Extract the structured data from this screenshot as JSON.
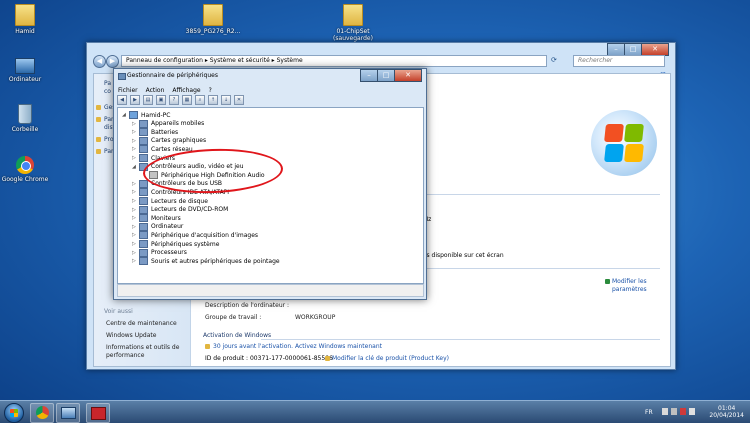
{
  "desktop": {
    "icons": [
      {
        "label": "Hamid"
      },
      {
        "label": "3859_PG276_R2..."
      },
      {
        "label": "01-ChipSet (sauvegarde)"
      },
      {
        "label": "Ordinateur"
      },
      {
        "label": "Corbeille"
      },
      {
        "label": "Google Chrome"
      }
    ]
  },
  "explorer": {
    "address": "Panneau de configuration  ▸  Système et sécurité  ▸  Système",
    "search_placeholder": "Rechercher",
    "left_pane": {
      "truncated": [
        "Pa",
        "co",
        "Ges",
        "Par",
        "dist",
        "Pro",
        "Par"
      ],
      "see_also": "Voir aussi",
      "links": [
        "Centre de maintenance",
        "Windows Update",
        "Informations et outils de",
        "performance"
      ]
    },
    "right": {
      "ghz": "GHz",
      "screen_note": "pas disponible sur cet écran",
      "modify_link": "Modifier les",
      "modify_link2": "paramètres",
      "rows": [
        {
          "label": "Description de l'ordinateur :",
          "value": ""
        },
        {
          "label": "Groupe de travail :",
          "value": "WORKGROUP"
        }
      ],
      "activation_title": "Activation de Windows",
      "activation_text": "30 jours avant l'activation. Activez Windows maintenant",
      "product_id": "ID de produit : 00371-177-0000061-85586",
      "product_key_link": "Modifier la clé de produit (Product Key)"
    }
  },
  "device_manager": {
    "title": "Gestionnaire de périphériques",
    "menu": [
      "Fichier",
      "Action",
      "Affichage",
      "?"
    ],
    "tree": [
      {
        "label": "Hamid-PC",
        "level": 0,
        "expanded": true,
        "icon": "computer"
      },
      {
        "label": "Appareils mobiles",
        "level": 1
      },
      {
        "label": "Batteries",
        "level": 1
      },
      {
        "label": "Cartes graphiques",
        "level": 1
      },
      {
        "label": "Cartes réseau",
        "level": 1
      },
      {
        "label": "Claviers",
        "level": 1
      },
      {
        "label": "Contrôleurs audio, vidéo et jeu",
        "level": 1,
        "expanded": true
      },
      {
        "label": "Périphérique High Definition Audio",
        "level": 2,
        "icon": "audio"
      },
      {
        "label": "Contrôleurs de bus USB",
        "level": 1
      },
      {
        "label": "Contrôleurs IDE ATA/ATAPI",
        "level": 1
      },
      {
        "label": "Lecteurs de disque",
        "level": 1
      },
      {
        "label": "Lecteurs de DVD/CD-ROM",
        "level": 1
      },
      {
        "label": "Moniteurs",
        "level": 1
      },
      {
        "label": "Ordinateur",
        "level": 1
      },
      {
        "label": "Périphérique d'acquisition d'images",
        "level": 1
      },
      {
        "label": "Périphériques système",
        "level": 1
      },
      {
        "label": "Processeurs",
        "level": 1
      },
      {
        "label": "Souris et autres périphériques de pointage",
        "level": 1
      }
    ]
  },
  "taskbar": {
    "lang": "FR",
    "time": "01:04",
    "date": "20/04/2014"
  },
  "colors": {
    "annotation": "#e0161b",
    "link": "#1a52a8"
  }
}
